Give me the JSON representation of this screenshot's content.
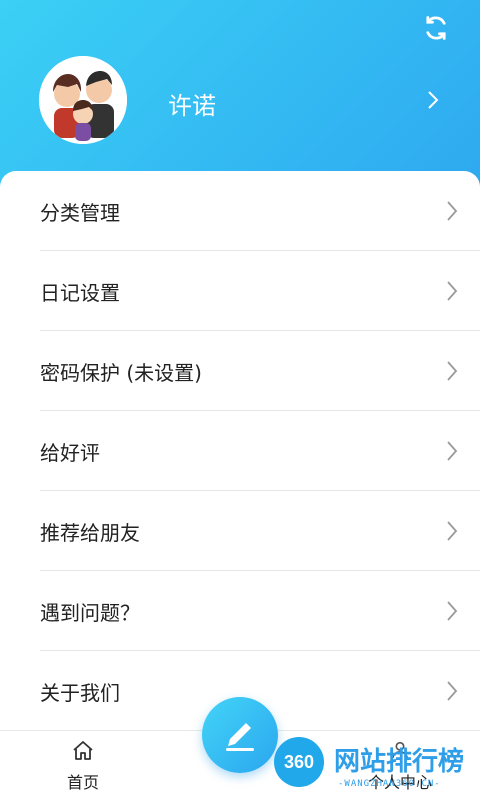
{
  "header": {
    "username": "许诺",
    "colors": {
      "gradient_start": "#3bd0f5",
      "gradient_end": "#2ea8f0"
    },
    "icons": {
      "sync": "sync-icon",
      "chevron": "chevron-right-icon",
      "avatar": "family-avatar"
    }
  },
  "menu": {
    "items": [
      {
        "label": "分类管理"
      },
      {
        "label": "日记设置"
      },
      {
        "label": "密码保护 (未设置)"
      },
      {
        "label": "给好评"
      },
      {
        "label": "推荐给朋友"
      },
      {
        "label": "遇到问题？"
      },
      {
        "label": "关于我们"
      }
    ]
  },
  "tabbar": {
    "home_label": "首页",
    "center_label": "个人中心",
    "fab_icon": "edit-icon"
  },
  "watermark": {
    "badge": "360",
    "text": "网站排行榜",
    "sub": "-WANGZHAN360.CN-"
  }
}
